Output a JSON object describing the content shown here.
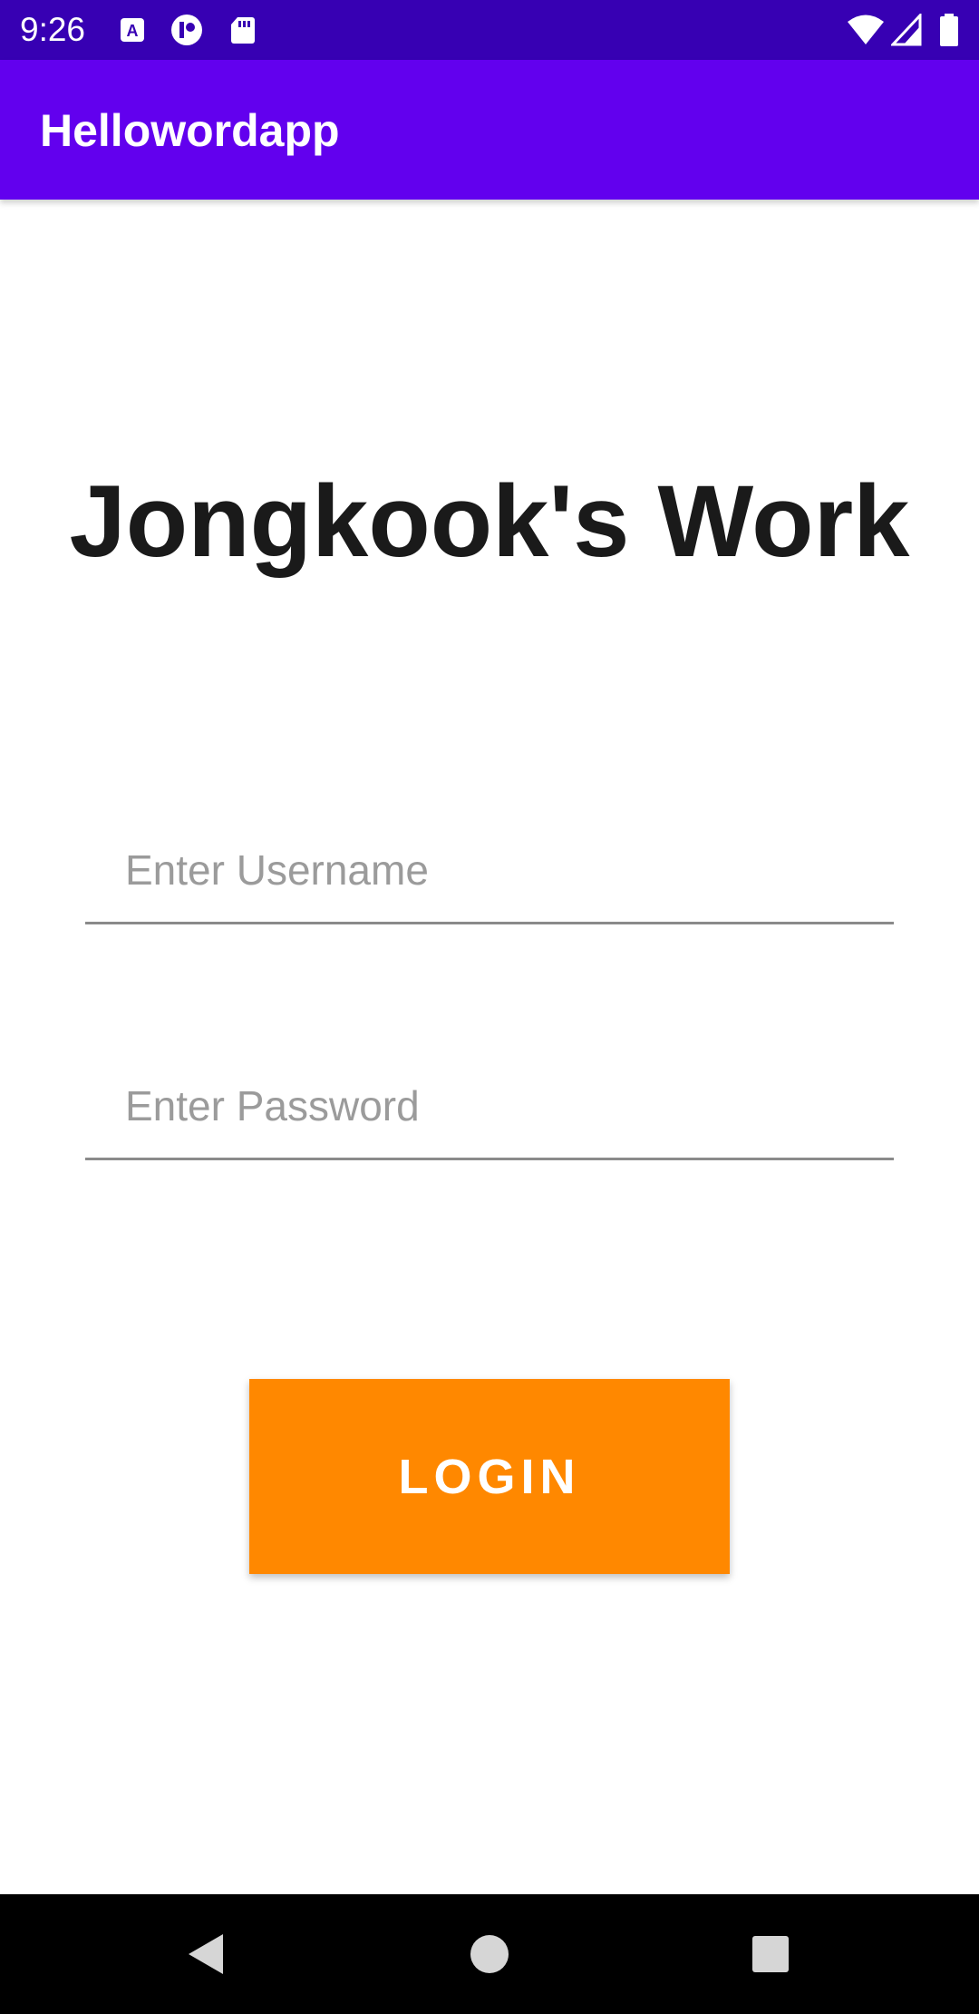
{
  "status_bar": {
    "time": "9:26",
    "icons": [
      "accessibility-icon",
      "notification-app-icon",
      "sd-card-icon",
      "wifi-icon",
      "signal-icon",
      "battery-icon"
    ]
  },
  "app_bar": {
    "title": "Hellowordapp"
  },
  "main": {
    "heading": "Jongkook's Work",
    "username_placeholder": "Enter Username",
    "password_placeholder": "Enter Password",
    "login_label": "LOGIN"
  },
  "navigation": {
    "buttons": [
      "back-icon",
      "home-icon",
      "recents-icon"
    ]
  },
  "colors": {
    "status_bar": "#3700B3",
    "app_bar": "#6200EE",
    "button": "#FF8800",
    "nav_bar": "#000000"
  }
}
